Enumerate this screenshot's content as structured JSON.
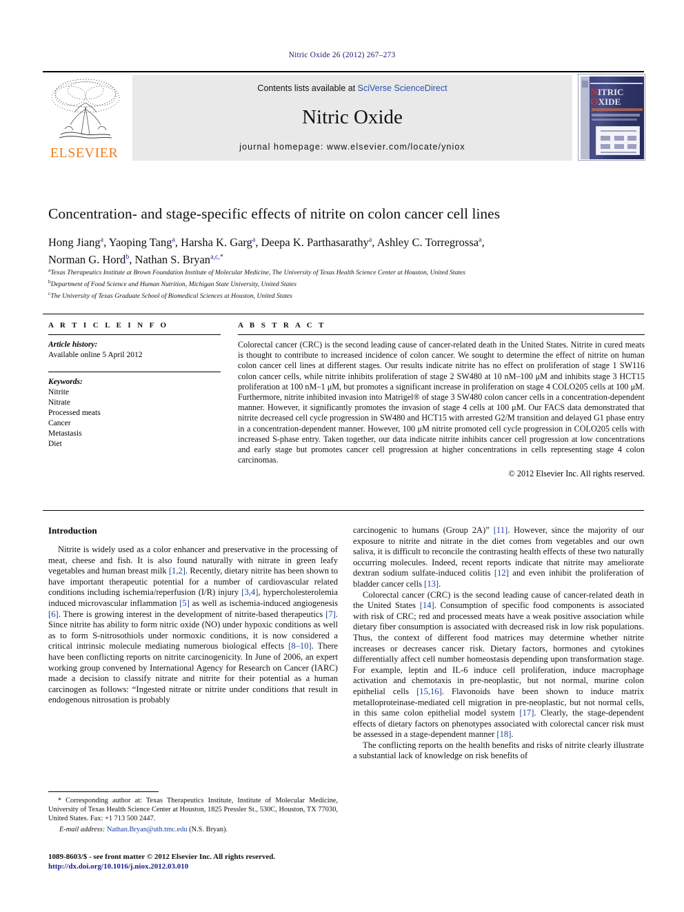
{
  "running_head": "Nitric Oxide 26 (2012) 267–273",
  "masthead": {
    "contents_prefix": "Contents lists available at ",
    "contents_link": "SciVerse ScienceDirect",
    "journal_name": "Nitric Oxide",
    "homepage": "journal homepage: www.elsevier.com/locate/yniox",
    "publisher": "ELSEVIER",
    "cover": {
      "line1_cap": "N",
      "line1_rest": "ITRIC",
      "line2_cap": "O",
      "line2_rest": "XIDE"
    }
  },
  "article": {
    "title": "Concentration- and stage-specific effects of nitrite on colon cancer cell lines",
    "authors_line1": "Hong Jiang a, Yaoping Tang a, Harsha K. Garg a, Deepa K. Parthasarathy a, Ashley C. Torregrossa a,",
    "authors_line2": "Norman G. Hord b, Nathan S. Bryan a,c,*",
    "affiliations": [
      {
        "mark": "a",
        "text": "Texas Therapeutics Institute at Brown Foundation Institute of Molecular Medicine, The University of Texas Health Science Center at Houston, United States"
      },
      {
        "mark": "b",
        "text": "Department of Food Science and Human Nutrition, Michigan State University, United States"
      },
      {
        "mark": "c",
        "text": "The University of Texas Graduate School of Biomedical Sciences at Houston, United States"
      }
    ]
  },
  "article_info": {
    "heading": "A R T I C L E  I N F O",
    "history_label": "Article history:",
    "history_value": "Available online 5 April 2012",
    "keywords_label": "Keywords:",
    "keywords": [
      "Nitrite",
      "Nitrate",
      "Processed meats",
      "Cancer",
      "Metastasis",
      "Diet"
    ]
  },
  "abstract": {
    "heading": "A B S T R A C T",
    "text": "Colorectal cancer (CRC) is the second leading cause of cancer-related death in the United States. Nitrite in cured meats is thought to contribute to increased incidence of colon cancer. We sought to determine the effect of nitrite on human colon cancer cell lines at different stages. Our results indicate nitrite has no effect on proliferation of stage 1 SW116 colon cancer cells, while nitrite inhibits proliferation of stage 2 SW480 at 10 nM–100 μM and inhibits stage 3 HCT15 proliferation at 100 nM–1 μM, but promotes a significant increase in proliferation on stage 4 COLO205 cells at 100 μM. Furthermore, nitrite inhibited invasion into Matrigel® of stage 3 SW480 colon cancer cells in a concentration-dependent manner. However, it significantly promotes the invasion of stage 4 cells at 100 μM. Our FACS data demonstrated that nitrite decreased cell cycle progression in SW480 and HCT15 with arrested G2/M transition and delayed G1 phase entry in a concentration-dependent manner. However, 100 μM nitrite promoted cell cycle progression in COLO205 cells with increased S-phase entry. Taken together, our data indicate nitrite inhibits cancer cell progression at low concentrations and early stage but promotes cancer cell progression at higher concentrations in cells representing stage 4 colon carcinomas.",
    "copyright": "© 2012 Elsevier Inc. All rights reserved."
  },
  "introduction": {
    "heading": "Introduction",
    "left_p1": "Nitrite is widely used as a color enhancer and preservative in the processing of meat, cheese and fish. It is also found naturally with nitrate in green leafy vegetables and human breast milk [1,2]. Recently, dietary nitrite has been shown to have important therapeutic potential for a number of cardiovascular related conditions including ischemia/reperfusion (I/R) injury [3,4], hypercholesterolemia induced microvascular inflammation [5] as well as ischemia-induced angiogenesis [6]. There is growing interest in the development of nitrite-based therapeutics [7]. Since nitrite has ability to form nitric oxide (NO) under hypoxic conditions as well as to form S-nitrosothiols under normoxic conditions, it is now considered a critical intrinsic molecule mediating numerous biological effects [8–10]. There have been conflicting reports on nitrite carcinogenicity. In June of 2006, an expert working group convened by International Agency for Research on Cancer (IARC) made a decision to classify nitrate and nitrite for their potential as a human carcinogen as follows: “Ingested nitrate or nitrite under conditions that result in endogenous nitrosation is probably",
    "right_p1": "carcinogenic to humans (Group 2A)” [11]. However, since the majority of our exposure to nitrite and nitrate in the diet comes from vegetables and our own saliva, it is difficult to reconcile the contrasting health effects of these two naturally occurring molecules. Indeed, recent reports indicate that nitrite may ameliorate dextran sodium sulfate-induced colitis [12] and even inhibit the proliferation of bladder cancer cells [13].",
    "right_p2": "Colorectal cancer (CRC) is the second leading cause of cancer-related death in the United States [14]. Consumption of specific food components is associated with risk of CRC; red and processed meats have a weak positive association while dietary fiber consumption is associated with decreased risk in low risk populations. Thus, the context of different food matrices may determine whether nitrite increases or decreases cancer risk. Dietary factors, hormones and cytokines differentially affect cell number homeostasis depending upon transformation stage. For example, leptin and IL-6 induce cell proliferation, induce macrophage activation and chemotaxis in pre-neoplastic, but not normal, murine colon epithelial cells [15,16]. Flavonoids have been shown to induce matrix metalloproteinase-mediated cell migration in pre-neoplastic, but not normal cells, in this same colon epithelial model system [17]. Clearly, the stage-dependent effects of dietary factors on phenotypes associated with colorectal cancer risk must be assessed in a stage-dependent manner [18].",
    "right_p3": "The conflicting reports on the health benefits and risks of nitrite clearly illustrate a substantial lack of knowledge on risk benefits of"
  },
  "footnote": {
    "star": "*",
    "corresponding": "Corresponding author at: Texas Therapeutics Institute, Institute of Molecular Medicine, University of Texas Health Science Center at Houston, 1825 Pressler St., 530C, Houston, TX 77030, United States. Fax: +1 713 500 2447.",
    "email_label": "E-mail address:",
    "email": "Nathan.Bryan@uth.tmc.edu",
    "email_suffix": "(N.S. Bryan)."
  },
  "imprint": {
    "line": "1089-8603/$ - see front matter © 2012 Elsevier Inc. All rights reserved.",
    "doi": "http://dx.doi.org/10.1016/j.niox.2012.03.010"
  }
}
